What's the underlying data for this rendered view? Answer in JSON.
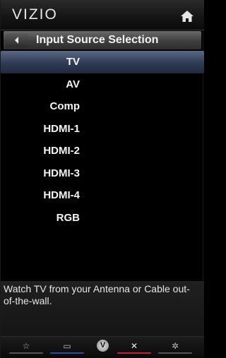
{
  "header": {
    "logo": "VIZIO",
    "home_icon": "home-icon"
  },
  "titlebar": {
    "back_icon": "back-arrow-icon",
    "title": "Input Source Selection"
  },
  "menu": {
    "selected_index": 0,
    "items": [
      {
        "label": "TV"
      },
      {
        "label": "AV"
      },
      {
        "label": "Comp"
      },
      {
        "label": "HDMI-1"
      },
      {
        "label": "HDMI-2"
      },
      {
        "label": "HDMI-3"
      },
      {
        "label": "HDMI-4"
      },
      {
        "label": "RGB"
      }
    ]
  },
  "description": {
    "text": "Watch TV from your Antenna or Cable out-of-the-wall."
  },
  "bottombar": {
    "buttons": [
      {
        "name": "favorites",
        "icon": "star-icon",
        "glyph": "☆",
        "color": "#555555"
      },
      {
        "name": "input",
        "icon": "input-icon",
        "glyph": "▭",
        "color": "#2a4fa0"
      },
      {
        "name": "vizio-internet-apps",
        "icon": "v-icon",
        "glyph": "V",
        "color": "#000000"
      },
      {
        "name": "exit",
        "icon": "close-icon",
        "glyph": "✕",
        "color": "#c0203a"
      },
      {
        "name": "settings",
        "icon": "gear-icon",
        "glyph": "✲",
        "color": "#555555"
      }
    ]
  },
  "colors": {
    "selected_bg": "#3a4868",
    "bar_bg": "#141414"
  }
}
